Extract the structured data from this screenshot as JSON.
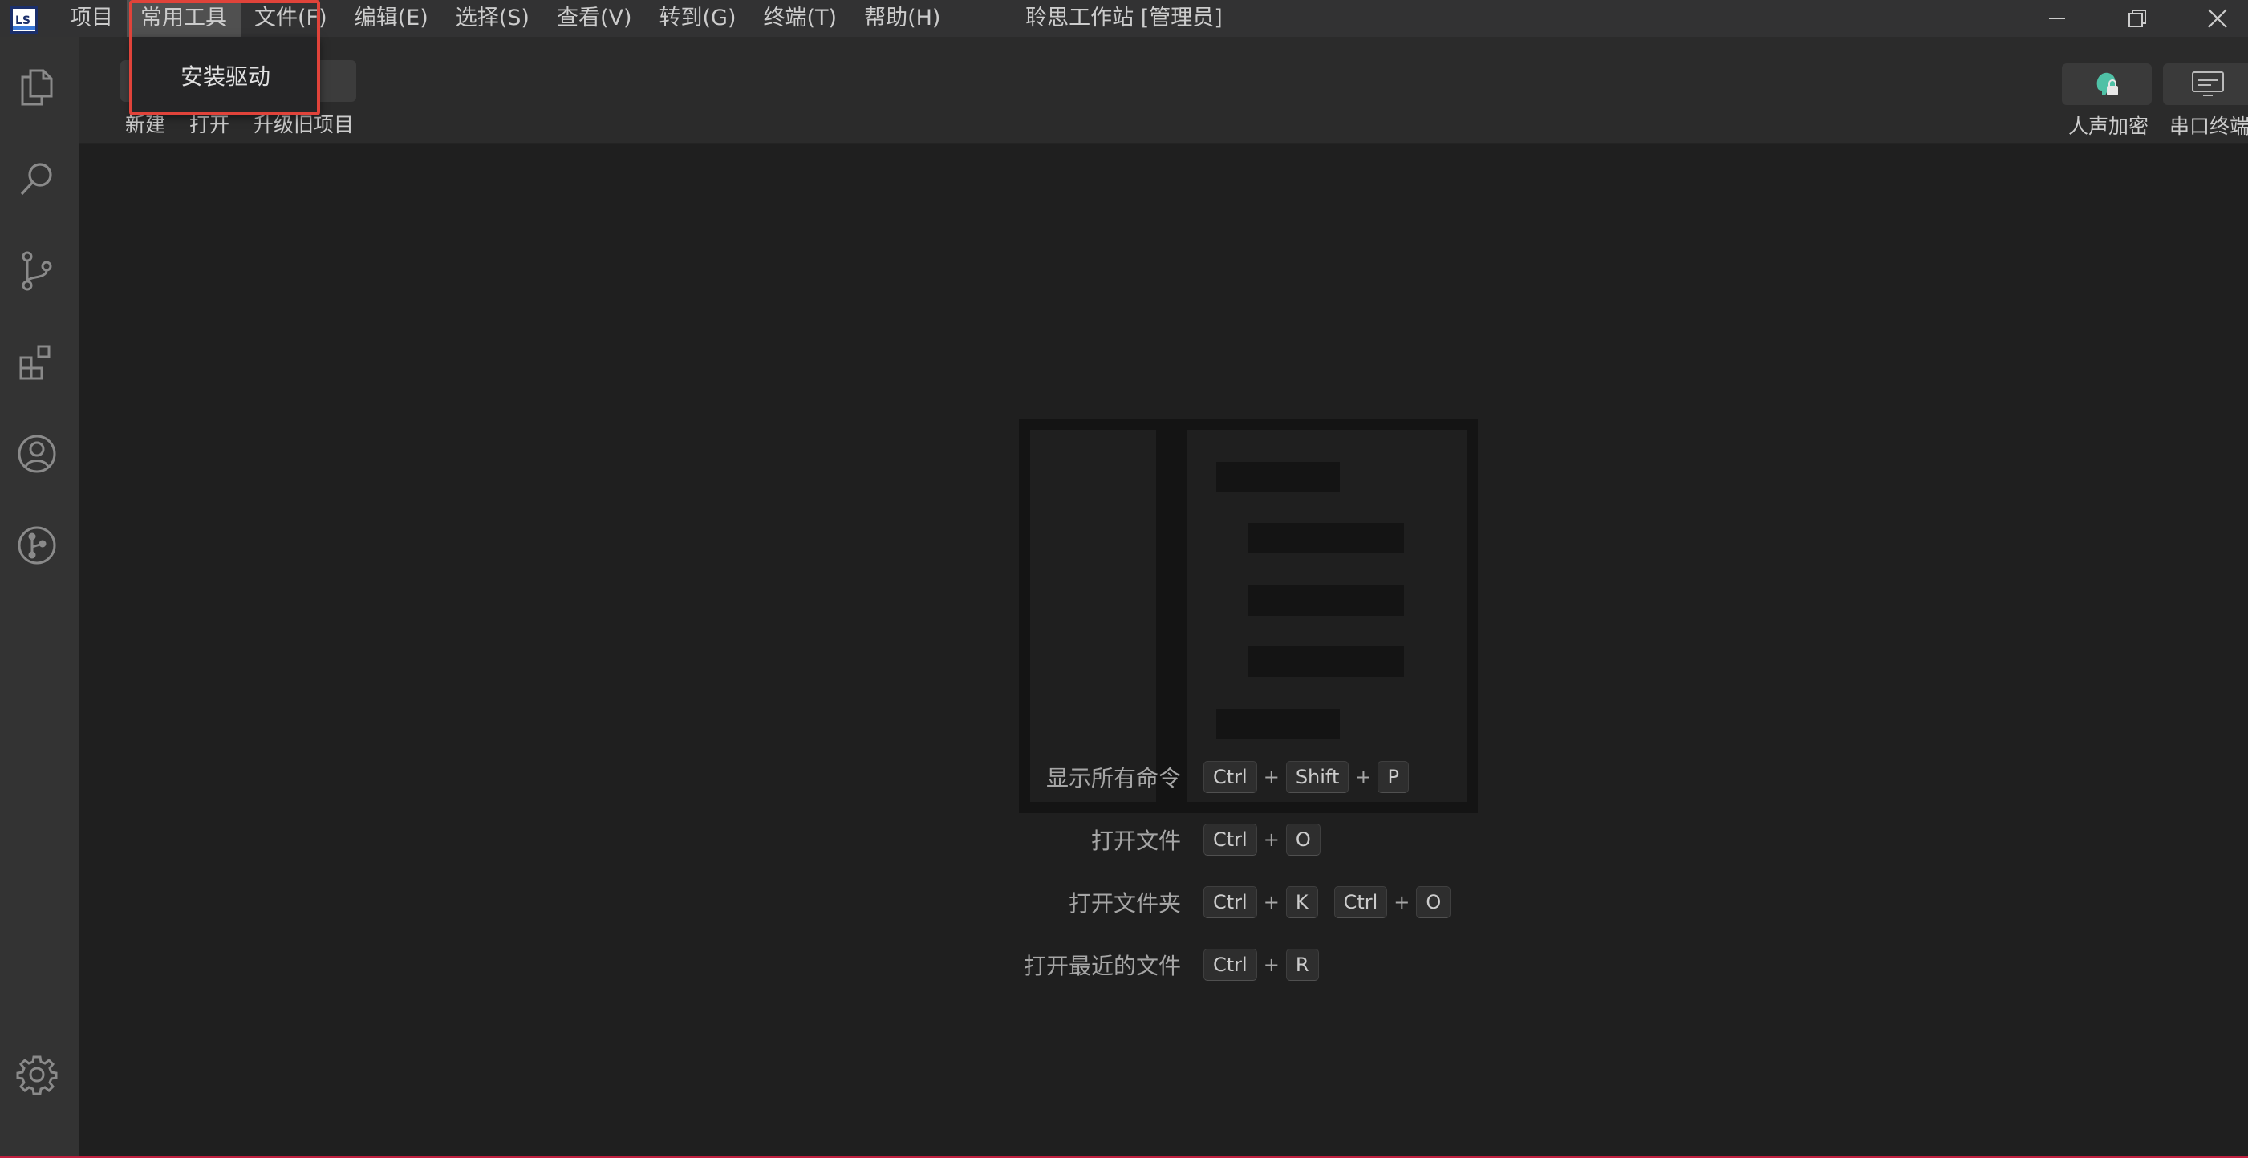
{
  "window": {
    "title": "聆思工作站 [管理员]"
  },
  "menu": {
    "items": [
      "项目",
      "常用工具",
      "文件(F)",
      "编辑(E)",
      "选择(S)",
      "查看(V)",
      "转到(G)",
      "终端(T)",
      "帮助(H)"
    ],
    "active": "常用工具"
  },
  "dropdown": {
    "items": [
      "安装驱动"
    ]
  },
  "toolbar": {
    "left_labels": [
      "新建",
      "打开",
      "升级旧项目"
    ],
    "right_tools": [
      {
        "label": "人声加密",
        "icon": "voice-encrypt-icon"
      },
      {
        "label": "串口终端",
        "icon": "serial-terminal-icon"
      }
    ]
  },
  "activity_bar": {
    "icons": [
      "explorer-icon",
      "search-icon",
      "source-control-icon",
      "extensions-icon",
      "account-icon",
      "git-graph-icon",
      "settings-icon"
    ]
  },
  "editor": {
    "shortcuts": [
      {
        "label": "显示所有命令",
        "keys": [
          [
            "Ctrl",
            "Shift",
            "P"
          ]
        ]
      },
      {
        "label": "打开文件",
        "keys": [
          [
            "Ctrl",
            "O"
          ]
        ]
      },
      {
        "label": "打开文件夹",
        "keys": [
          [
            "Ctrl",
            "K"
          ],
          [
            "Ctrl",
            "O"
          ]
        ]
      },
      {
        "label": "打开最近的文件",
        "keys": [
          [
            "Ctrl",
            "R"
          ]
        ]
      }
    ]
  },
  "colors": {
    "background": "#1f1f1f",
    "titlebar": "#323233",
    "activity_bar": "#333333",
    "highlight": "#e0433a"
  }
}
